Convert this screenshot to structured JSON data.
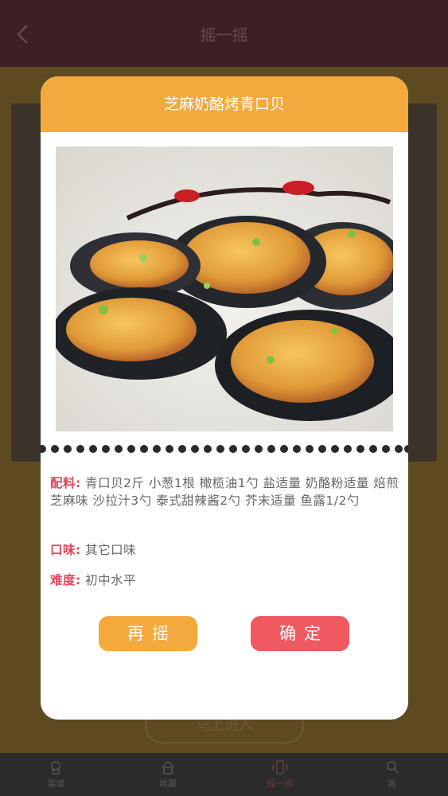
{
  "nav": {
    "title": "摇一摇"
  },
  "background": {
    "bottom_button": "马上进入"
  },
  "tabs": [
    {
      "label": "菜谱",
      "icon": "chef-icon"
    },
    {
      "label": "收藏",
      "icon": "home-icon"
    },
    {
      "label": "摇一摇",
      "icon": "shake-icon"
    },
    {
      "label": "我",
      "icon": "search-icon"
    }
  ],
  "modal": {
    "title": "芝麻奶酪烤青口贝",
    "ingredients_label": "配料:",
    "ingredients": "青口贝2斤  小葱1根  橄榄油1勺  盐适量  奶酪粉适量  焙煎芝麻味  沙拉汁3勺  泰式甜辣酱2勺  芥末适量  鱼露1/2勺",
    "taste_label": "口味:",
    "taste": "其它口味",
    "difficulty_label": "难度:",
    "difficulty": "初中水平",
    "again_button": "再摇",
    "confirm_button": "确定"
  },
  "colors": {
    "header": "#f4a93d",
    "confirm": "#f05a5e",
    "label": "#e5455a"
  }
}
